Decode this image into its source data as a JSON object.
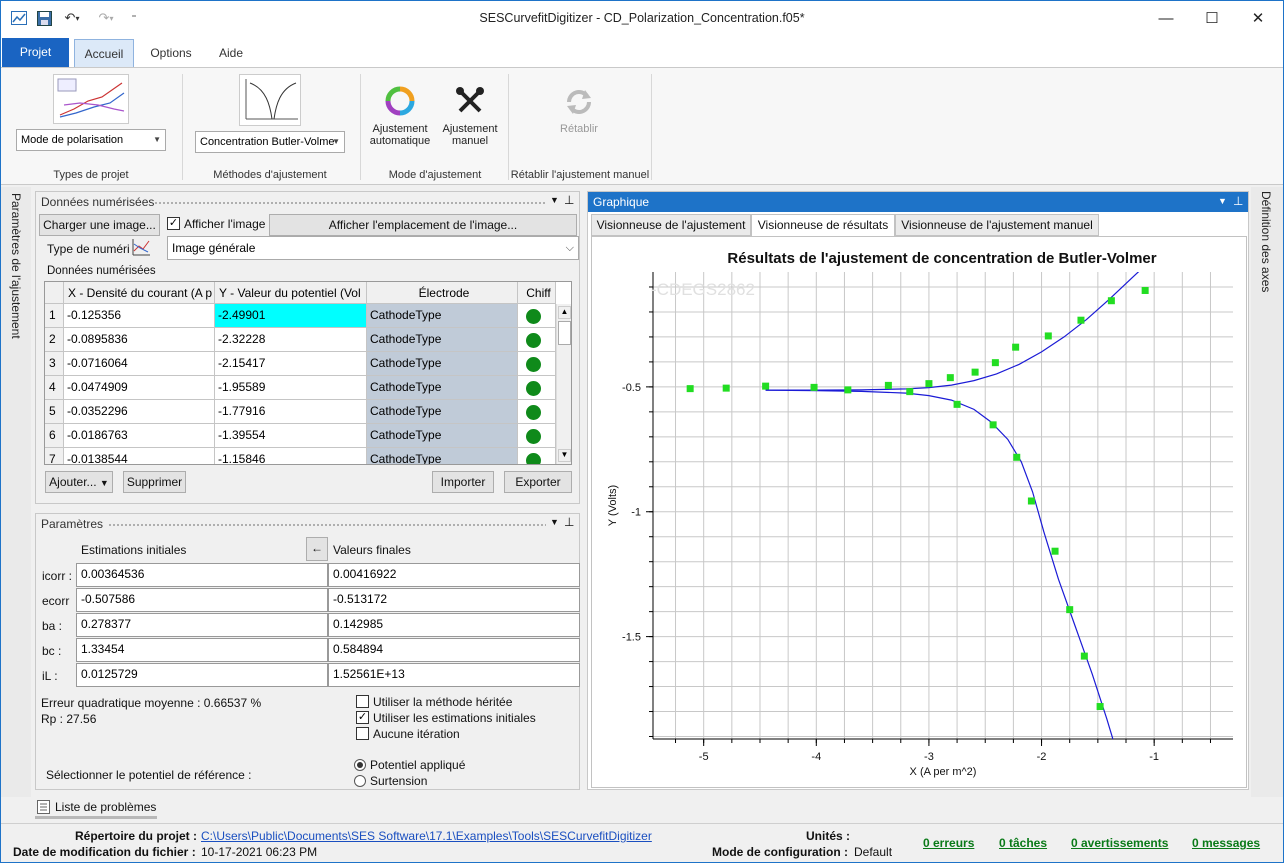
{
  "window": {
    "title": "SESCurvefitDigitizer - CD_Polarization_Concentration.f05*",
    "min": "—",
    "max": "☐",
    "close": "✕"
  },
  "ribbon_tabs": [
    "Projet",
    "Accueil",
    "Options",
    "Aide"
  ],
  "ribbon": {
    "project_type_value": "Mode de polarisation",
    "project_type_label": "Types de projet",
    "method_value": "Concentration Butler-Volme",
    "method_label": "Méthodes d'ajustement",
    "auto_fit_label_1": "Ajustement",
    "auto_fit_label_2": "automatique",
    "manual_fit_label_1": "Ajustement",
    "manual_fit_label_2": "manuel",
    "mode_label": "Mode d'ajustement",
    "restore_label": "Rétablir",
    "restore_group_label": "Rétablir l'ajustement manuel"
  },
  "left_sidebar_label": "Paramètres de l'ajustement",
  "right_sidebar_label": "Définition des axes",
  "digitized": {
    "panel_title": "Données numérisées",
    "load_image_button": "Charger une image...",
    "show_image_label": "Afficher l'image",
    "show_image_location_button": "Afficher l'emplacement de l'image...",
    "digitizer_type_label": "Type de numéri",
    "digitizer_type_value": "Image générale",
    "group_title": "Données numérisées",
    "columns": [
      "X - Densité du courant (A p",
      "Y - Valeur du potentiel (Vol",
      "Électrode",
      "Chiff"
    ],
    "rows": [
      {
        "n": "1",
        "x": "-0.125356",
        "y": "-2.49901",
        "el": "CathodeType"
      },
      {
        "n": "2",
        "x": "-0.0895836",
        "y": "-2.32228",
        "el": "CathodeType"
      },
      {
        "n": "3",
        "x": "-0.0716064",
        "y": "-2.15417",
        "el": "CathodeType"
      },
      {
        "n": "4",
        "x": "-0.0474909",
        "y": "-1.95589",
        "el": "CathodeType"
      },
      {
        "n": "5",
        "x": "-0.0352296",
        "y": "-1.77916",
        "el": "CathodeType"
      },
      {
        "n": "6",
        "x": "-0.0186763",
        "y": "-1.39554",
        "el": "CathodeType"
      },
      {
        "n": "7",
        "x": "-0.0138544",
        "y": "-1.15846",
        "el": "CathodeType"
      }
    ],
    "add_button": "Ajouter...",
    "delete_button": "Supprimer",
    "import_button": "Importer",
    "export_button": "Exporter"
  },
  "params": {
    "panel_title": "Paramètres",
    "initial_header": "Estimations initiales",
    "copy_button": "←",
    "final_header": "Valeurs finales",
    "rows": [
      {
        "label": "icorr :",
        "initial": "0.00364536",
        "final": "0.00416922"
      },
      {
        "label": "ecorr",
        "initial": "-0.507586",
        "final": "-0.513172"
      },
      {
        "label": "ba :",
        "initial": "0.278377",
        "final": "0.142985"
      },
      {
        "label": "bc :",
        "initial": "1.33454",
        "final": "0.584894"
      },
      {
        "label": "iL :",
        "initial": "0.0125729",
        "final": "1.52561E+13"
      }
    ],
    "rms_error": "Erreur quadratique moyenne : 0.66537 %",
    "rp": "Rp : 27.56",
    "legacy_method": "Utiliser la méthode héritée",
    "use_initial": "Utiliser les estimations initiales",
    "no_iteration": "Aucune itération",
    "ref_label": "Sélectionner le potentiel de référence :",
    "applied_potential": "Potentiel appliqué",
    "overpotential": "Surtension"
  },
  "problems_tab": "Liste de problèmes",
  "chart_panel": {
    "title": "Graphique",
    "tabs": [
      "Visionneuse de l'ajustement",
      "Visionneuse de résultats",
      "Visionneuse de l'ajustement manuel"
    ],
    "watermark": "-CDEGS2862"
  },
  "chart_data": {
    "type": "scatter",
    "title": "Résultats de l'ajustement de concentration de Butler-Volmer",
    "xlabel": "X (A per m^2)",
    "ylabel": "Y (Volts)",
    "xlim": [
      -5.45,
      -0.3
    ],
    "ylim": [
      -1.91,
      -0.04
    ],
    "xticks": [
      -5,
      -4,
      -3,
      -2,
      -1
    ],
    "yticks": [
      -0.5,
      -1,
      -1.5
    ],
    "grid": true,
    "series": [
      {
        "name": "",
        "marker": "square",
        "color": "#22dd22",
        "x": [
          -5.12,
          -4.8,
          -4.45,
          -4.02,
          -3.72,
          -3.36,
          -3.17,
          -3.0,
          -2.81,
          -2.59,
          -2.41,
          -2.23,
          -1.94,
          -1.65,
          -1.38,
          -1.08,
          -2.75,
          -2.43,
          -2.22,
          -2.09,
          -1.88,
          -1.75,
          -1.62,
          -1.48
        ],
        "y": [
          -0.507,
          -0.505,
          -0.497,
          -0.502,
          -0.512,
          -0.494,
          -0.519,
          -0.487,
          -0.463,
          -0.441,
          -0.403,
          -0.341,
          -0.296,
          -0.233,
          -0.155,
          -0.114,
          -0.57,
          -0.652,
          -0.782,
          -0.957,
          -1.158,
          -1.392,
          -1.578,
          -1.78
        ]
      },
      {
        "name": "",
        "type": "line",
        "color": "#1b1bd6",
        "x": [
          -4.45,
          -4.0,
          -3.6,
          -3.2,
          -3.0,
          -2.8,
          -2.6,
          -2.4,
          -2.2,
          -2.0,
          -1.8,
          -1.6,
          -1.4,
          -1.2,
          -1.0,
          -0.94
        ],
        "y": [
          -0.513,
          -0.513,
          -0.512,
          -0.508,
          -0.503,
          -0.493,
          -0.475,
          -0.448,
          -0.41,
          -0.36,
          -0.3,
          -0.23,
          -0.15,
          -0.065,
          0.02,
          0.04
        ]
      },
      {
        "name": "",
        "type": "line",
        "color": "#1b1bd6",
        "x": [
          -4.45,
          -4.0,
          -3.6,
          -3.2,
          -3.0,
          -2.8,
          -2.6,
          -2.45,
          -2.3,
          -2.18,
          -2.08,
          -1.98,
          -1.85,
          -1.7,
          -1.55,
          -1.42,
          -1.32
        ],
        "y": [
          -0.513,
          -0.515,
          -0.518,
          -0.525,
          -0.535,
          -0.553,
          -0.59,
          -0.64,
          -0.71,
          -0.8,
          -0.92,
          -1.08,
          -1.27,
          -1.46,
          -1.65,
          -1.83,
          -1.98
        ]
      }
    ]
  },
  "status": {
    "project_dir_label": "Répertoire du projet :",
    "project_dir": "C:\\Users\\Public\\Documents\\SES Software\\17.1\\Examples\\Tools\\SESCurvefitDigitizer",
    "modified_label": "Date de modification du fichier :",
    "modified": "10-17-2021 06:23 PM",
    "units_label": "Unités :",
    "config_label": "Mode de configuration :",
    "config": "Default",
    "errors": "0 erreurs",
    "tasks": "0 tâches",
    "warnings": "0 avertissements",
    "messages": "0 messages"
  }
}
